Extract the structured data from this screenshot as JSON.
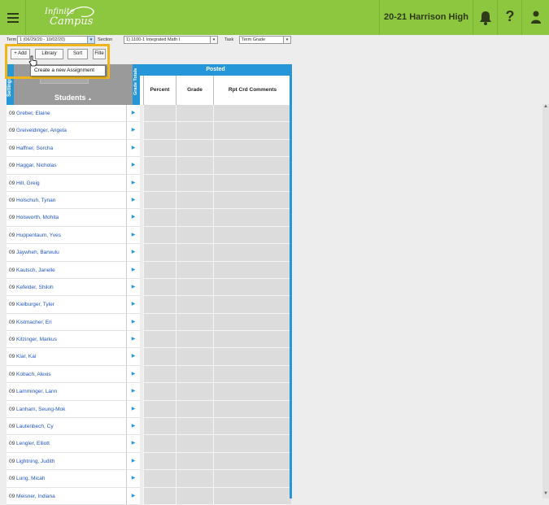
{
  "header": {
    "logo_line1": "Infinite",
    "logo_line2": "Campus",
    "school_name": "20-21 Harrison High",
    "help_symbol": "?",
    "bar_color": "#8dc63f"
  },
  "filters": {
    "term_label": "Term",
    "term_value": "1 (06/29/20 - 10/02/20)",
    "section_label": "Section",
    "section_value": "1) 1100-1 Integrated Math I",
    "task_label": "Task",
    "task_value": "Term Grade"
  },
  "toolbar": {
    "add_label": "+ Add",
    "library_label": "Library",
    "sort_label": "Sort",
    "filter_label": "Filte"
  },
  "tooltip": {
    "text": "Create a new Assignment"
  },
  "grid": {
    "settings_label": "Settings",
    "students_label": "Students",
    "sort_indicator": "▲",
    "grade_totals_label": "Grade Totals",
    "posted_label": "Posted",
    "columns": [
      "Percent",
      "Grade",
      "Rpt Crd Comments"
    ],
    "accent_color": "#2596d8",
    "students": [
      {
        "grade": "09",
        "name": "Greber, Elaine"
      },
      {
        "grade": "09",
        "name": "Greiveldinger, Angela"
      },
      {
        "grade": "09",
        "name": "Haffner, Sorcha"
      },
      {
        "grade": "09",
        "name": "Haggar, Nicholas"
      },
      {
        "grade": "09",
        "name": "Hill, Greig"
      },
      {
        "grade": "09",
        "name": "Holschuh, Tynan"
      },
      {
        "grade": "09",
        "name": "Holsworth, Mohita"
      },
      {
        "grade": "09",
        "name": "Huppentaum, Yves"
      },
      {
        "grade": "09",
        "name": "Jaywheh, Barwulu"
      },
      {
        "grade": "09",
        "name": "Kautsch, Janelle"
      },
      {
        "grade": "09",
        "name": "Kefelder, Shiloh"
      },
      {
        "grade": "09",
        "name": "Kielburger, Tyler"
      },
      {
        "grade": "09",
        "name": "Kistmacher, Eri"
      },
      {
        "grade": "09",
        "name": "Kitzinger, Markus"
      },
      {
        "grade": "09",
        "name": "Klar, Kai"
      },
      {
        "grade": "09",
        "name": "Kobach, Alexis"
      },
      {
        "grade": "09",
        "name": "Lamminger, Lann"
      },
      {
        "grade": "09",
        "name": "Lanham, Seung-Mok"
      },
      {
        "grade": "09",
        "name": "Lautenbech, Cy"
      },
      {
        "grade": "09",
        "name": "Lengler, Elliott"
      },
      {
        "grade": "09",
        "name": "Lightning, Judith"
      },
      {
        "grade": "09",
        "name": "Lung, Micah"
      },
      {
        "grade": "09",
        "name": "Meisner, Indiana"
      }
    ]
  }
}
